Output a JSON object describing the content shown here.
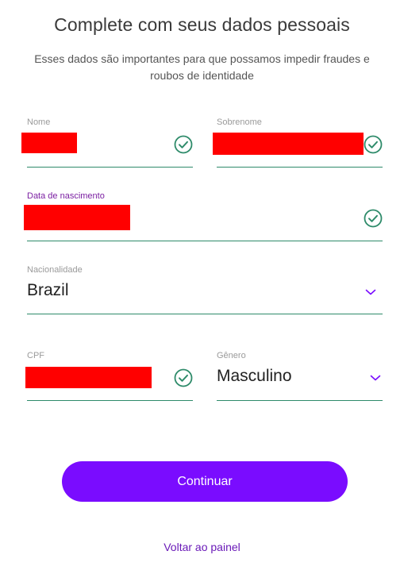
{
  "header": {
    "title": "Complete com seus dados pessoais",
    "subtitle": "Esses dados são importantes para que possamos impedir fraudes e roubos de identidade"
  },
  "form": {
    "nome": {
      "label": "Nome",
      "value": "",
      "redacted": true,
      "validated": true
    },
    "sobrenome": {
      "label": "Sobrenome",
      "value": "",
      "redacted": true,
      "validated": true
    },
    "data_nascimento": {
      "label": "Data de nascimento",
      "value": "",
      "redacted": true,
      "validated": true,
      "focused": true
    },
    "nacionalidade": {
      "label": "Nacionalidade",
      "value": "Brazil"
    },
    "cpf": {
      "label": "CPF",
      "value": "",
      "redacted": true,
      "validated": true
    },
    "genero": {
      "label": "Gênero",
      "value": "Masculino"
    }
  },
  "actions": {
    "continue_label": "Continuar",
    "back_link": "Voltar ao painel"
  },
  "icons": {
    "check": "check-circle-icon",
    "dropdown": "chevron-down-icon"
  },
  "colors": {
    "accent": "#7a0cff",
    "link": "#6a1ab8",
    "focused_label": "#7b1fa2",
    "underline": "#2e8b6a",
    "check": "#2e8b6a",
    "redaction": "#ff0000"
  }
}
